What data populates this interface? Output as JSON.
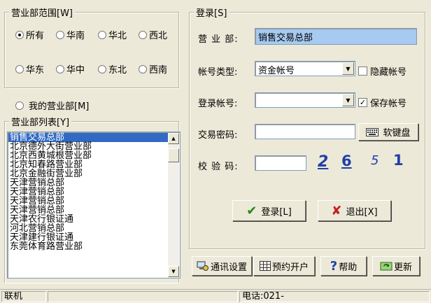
{
  "scope_group": {
    "legend": "营业部范围[W]",
    "regions": [
      {
        "label": "所有",
        "selected": true
      },
      {
        "label": "华南",
        "selected": false
      },
      {
        "label": "华北",
        "selected": false
      },
      {
        "label": "西北",
        "selected": false
      },
      {
        "label": "华东",
        "selected": false
      },
      {
        "label": "华中",
        "selected": false
      },
      {
        "label": "东北",
        "selected": false
      },
      {
        "label": "西南",
        "selected": false
      }
    ]
  },
  "my_branch": {
    "label": "我的营业部[M]",
    "selected": false
  },
  "branch_list": {
    "legend": "营业部列表[Y]",
    "items": [
      "销售交易总部",
      "北京德外大街营业部",
      "北京西黄城根营业部",
      "北京知春路营业部",
      "北京金融街营业部",
      "天津营销总部",
      "天津营销总部",
      "天津营销总部",
      "天津营销总部",
      "天津农行银证通",
      "河北营销总部",
      "天津建行银证通",
      "东莞体育路营业部"
    ],
    "selected_index": 0
  },
  "login": {
    "legend": "登录[S]",
    "branch_label": "营 业 部:",
    "branch_value": "销售交易总部",
    "account_type_label": "帐号类型:",
    "account_type_value": "资金帐号",
    "hide_account_label": "隐藏帐号",
    "hide_account_checked": false,
    "account_label": "登录帐号:",
    "account_value": "",
    "save_account_label": "保存帐号",
    "save_account_checked": true,
    "password_label": "交易密码:",
    "password_value": "",
    "keyboard_button": "软键盘",
    "captcha_label": "校 验 码:",
    "captcha_value": "",
    "captcha_chars": [
      "2",
      "6",
      "5",
      "1"
    ],
    "login_button": "登录[L]",
    "exit_button": "退出[X]"
  },
  "toolbar": {
    "comm_settings": "通讯设置",
    "open_account": "预约开户",
    "help": "帮助",
    "update": "更新"
  },
  "status": {
    "connection": "联机",
    "middle": "",
    "phone": "电话:021-"
  },
  "colors": {
    "window_bg": "#ECE9D8",
    "selection": "#316AC5",
    "highlight_field": "#A6CAF0",
    "captcha": "#1F3FA8",
    "login_check": "#1E8A1E",
    "exit_x": "#C81E1E"
  }
}
